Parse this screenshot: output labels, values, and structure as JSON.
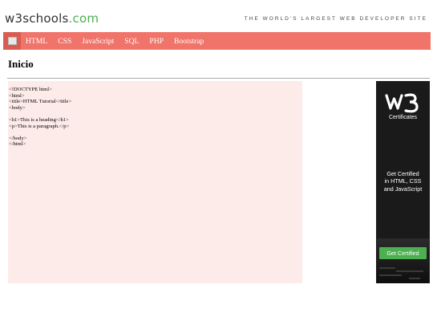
{
  "header": {
    "logo_main": "w3schools",
    "logo_suffix": ".com",
    "tagline": "THE WORLD'S LARGEST WEB DEVELOPER SITE"
  },
  "navbar": {
    "home_icon": "home-icon",
    "links": [
      "HTML",
      "CSS",
      "JavaScript",
      "SQL",
      "PHP",
      "Bootstrap"
    ]
  },
  "page": {
    "title": "Inicio"
  },
  "code": {
    "lines": [
      "<!DOCTYPE html>",
      "<html>",
      "<title>HTML Tutorial</title>",
      "<body>",
      "",
      "<h1>This is a heading</h1>",
      "<p>This is a paragraph.</p>",
      "",
      "</body>",
      "</html>"
    ]
  },
  "ad": {
    "logo_icon": "w3-logo-icon",
    "cert_label": "Certificates",
    "headline_lines": [
      "Get Certified",
      "in HTML, CSS",
      "and JavaScript"
    ],
    "cta_label": "Get Certified"
  },
  "colors": {
    "navbar": "#F0746A",
    "accent_green": "#4CAF50",
    "code_bg": "#FDEBE9",
    "ad_bg": "#1a1a1a"
  }
}
